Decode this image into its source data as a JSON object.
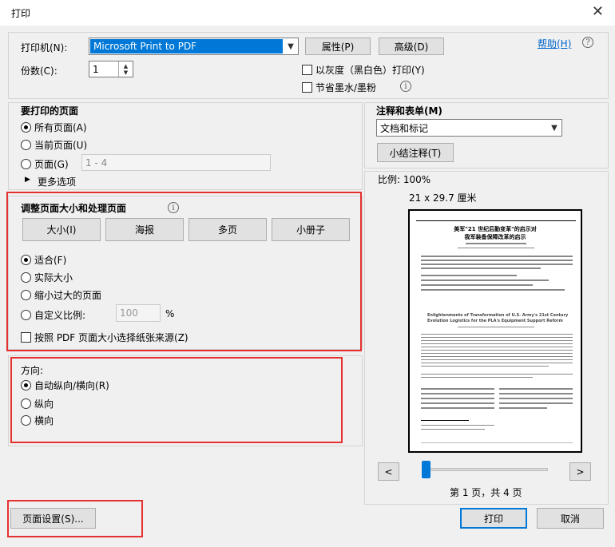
{
  "window": {
    "title": "打印",
    "close": "✕"
  },
  "printer": {
    "label": "打印机(N):",
    "selected": "Microsoft Print to PDF",
    "properties_btn": "属性(P)",
    "advanced_btn": "高级(D)",
    "help_link": "帮助(H)"
  },
  "copies": {
    "label": "份数(C):",
    "value": "1"
  },
  "options": {
    "grayscale": "以灰度（黑白色）打印(Y)",
    "save_ink": "节省墨水/墨粉"
  },
  "pages_to_print": {
    "title": "要打印的页面",
    "all": "所有页面(A)",
    "current": "当前页面(U)",
    "pages": "页面(G)",
    "pages_placeholder": "1 - 4",
    "more": "更多选项"
  },
  "sizing": {
    "title": "调整页面大小和处理页面",
    "buttons": [
      "大小(I)",
      "海报",
      "多页",
      "小册子"
    ],
    "fit": "适合(F)",
    "actual": "实际大小",
    "shrink": "缩小过大的页面",
    "custom": "自定义比例:",
    "custom_value": "100",
    "percent": "%",
    "paper_source": "按照 PDF 页面大小选择纸张来源(Z)"
  },
  "orientation": {
    "title": "方向:",
    "auto": "自动纵向/横向(R)",
    "portrait": "纵向",
    "landscape": "横向"
  },
  "comments": {
    "title": "注释和表单(M)",
    "selected": "文档和标记",
    "summarize_btn": "小结注释(T)"
  },
  "preview": {
    "scale": "比例: 100%",
    "size": "21 x 29.7 厘米",
    "page_title_1": "美军\"21 世纪后勤变革\"的启示对",
    "page_title_2": "我军装备保障改革的启示",
    "page_en_title": "Enlightenments of Transformation of U.S. Army's 21st Century",
    "page_en_title2": "Evolution Logistics for the PLA's Equipment Support Reform",
    "page_status": "第 1 页，共 4 页",
    "prev": "<",
    "next": ">",
    "progress": 0.0
  },
  "footer": {
    "page_setup": "页面设置(S)...",
    "print": "打印",
    "cancel": "取消"
  }
}
